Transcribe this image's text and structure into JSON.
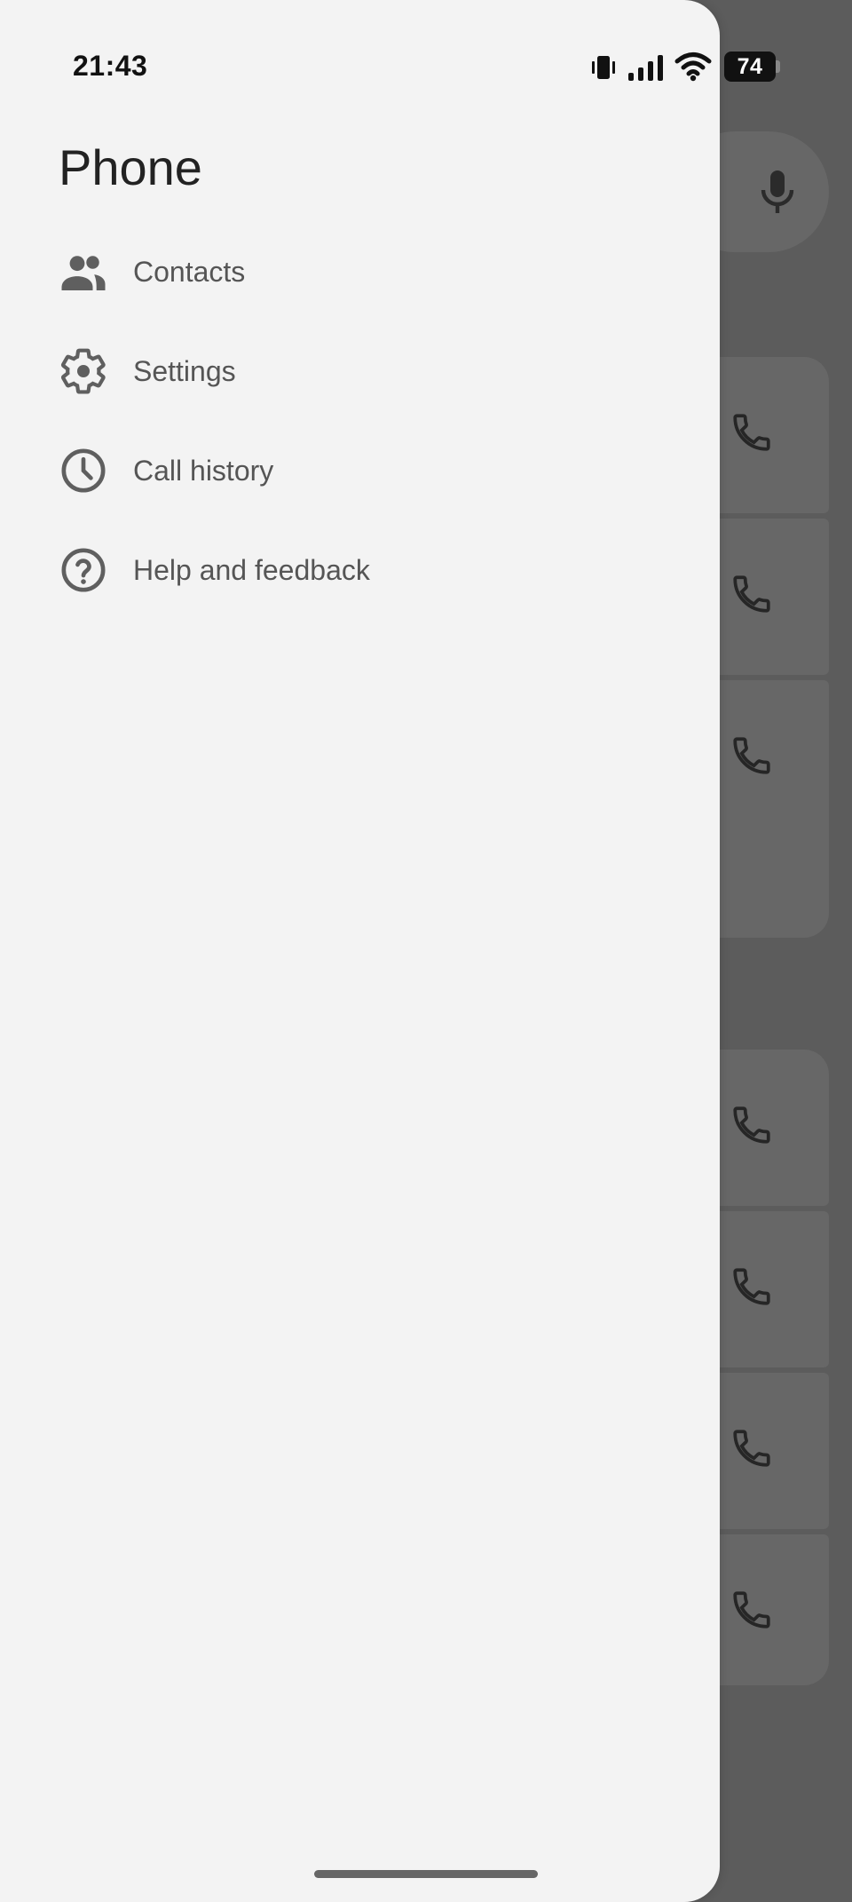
{
  "status_bar": {
    "time": "21:43",
    "battery": "74",
    "icons": [
      "vibrate-icon",
      "signal-icon",
      "wifi-icon",
      "battery-icon"
    ]
  },
  "drawer": {
    "title": "Phone",
    "items": [
      {
        "label": "Contacts",
        "icon": "contacts-icon"
      },
      {
        "label": "Settings",
        "icon": "gear-icon"
      },
      {
        "label": "Call history",
        "icon": "clock-icon"
      },
      {
        "label": "Help and feedback",
        "icon": "help-icon"
      }
    ]
  },
  "background": {
    "icons": [
      "mic-icon",
      "phone-icon"
    ]
  },
  "colors": {
    "drawer_bg": "#f3f3f3",
    "scrim": "#5c5c5c",
    "text_primary": "#222222",
    "text_secondary": "#555555",
    "icon": "#5f5f5f"
  }
}
